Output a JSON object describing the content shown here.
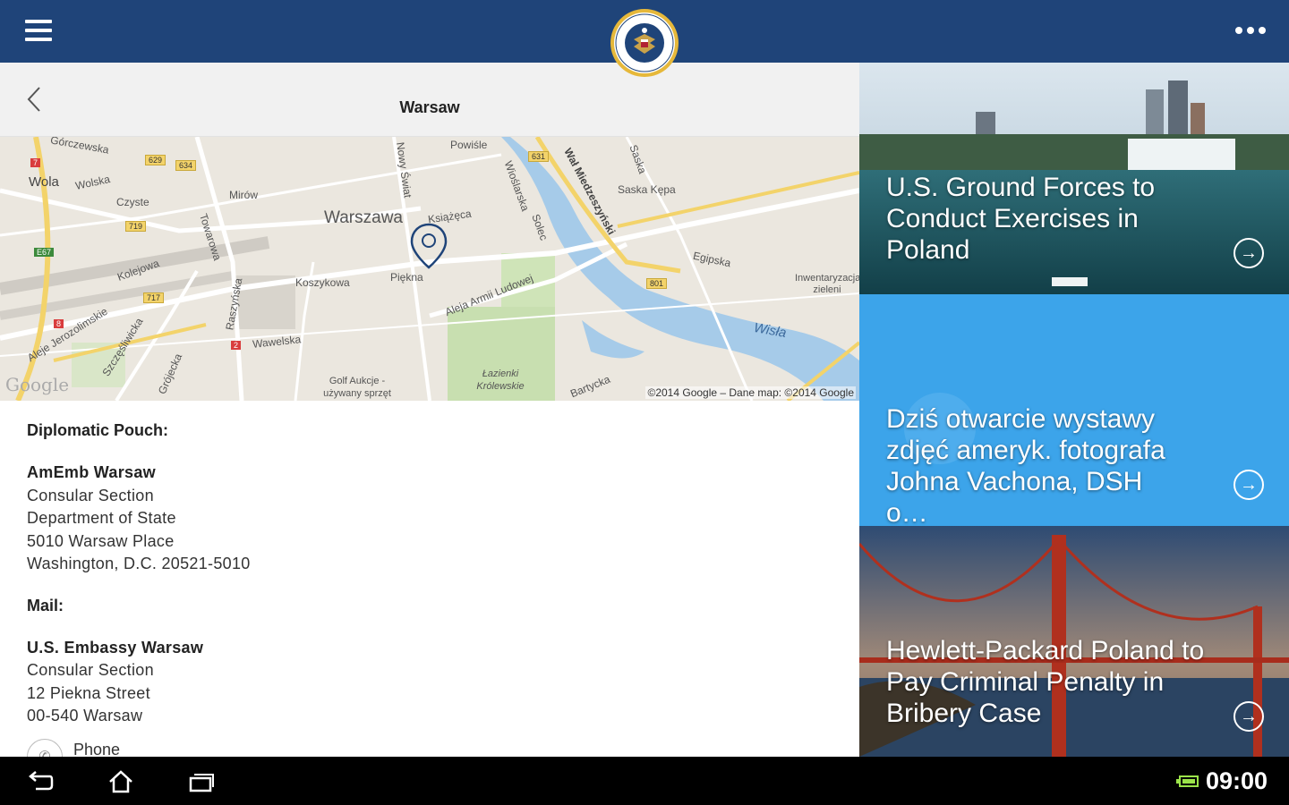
{
  "header": {
    "menu_icon": "hamburger-menu-icon",
    "logo": "us-embassy-seal",
    "more_icon": "overflow-menu-icon"
  },
  "subheader": {
    "title": "Warsaw",
    "back_icon": "chevron-left-icon"
  },
  "map": {
    "labels": {
      "gorczewska": "Górczewska",
      "wola": "Wola",
      "wolska": "Wolska",
      "czyste": "Czyste",
      "mirow": "Mirów",
      "towarowa": "Towarowa",
      "warszawa": "Warszawa",
      "ksiazeca": "Książęca",
      "nowy_swiat": "Nowy Świat",
      "powisle": "Powiśle",
      "wioslarska": "Wioślarska",
      "solec": "Solec",
      "wal_miedzeszynski": "Wał Miedzeszyński",
      "saska": "Saska",
      "saska_kepa": "Saska Kępa",
      "egipska": "Egipska",
      "inwentaryzacja": "Inwentaryzacja zieleni",
      "kolejowa": "Kolejowa",
      "koszykowa": "Koszykowa",
      "piekna": "Piękna",
      "aleja_armii": "Aleja Armii Ludowej",
      "raszynska": "Raszyńska",
      "wawelska": "Wawelska",
      "aleje_jerozolimskie": "Aleje Jerozolimskie",
      "szczesliwicka": "Szczęśliwicka",
      "grojecka": "Grójecka",
      "golf": "Golf Aukcje - używany sprzęt",
      "lazienki": "Łazienki Królewskie",
      "bartycka": "Bartycka",
      "wisla": "Wisła"
    },
    "shields": [
      "7",
      "629",
      "634",
      "719",
      "E67",
      "717",
      "8",
      "2",
      "631",
      "801"
    ],
    "copyright": "©2014 Google – Dane map: ©2014 Google",
    "google": "Google"
  },
  "details": {
    "pouch_heading": "Diplomatic Pouch:",
    "pouch_lines": [
      "AmEmb Warsaw",
      "Consular Section",
      "Department of State",
      "5010 Warsaw Place",
      "Washington, D.C. 20521-5010"
    ],
    "mail_heading": "Mail:",
    "mail_lines": [
      "U.S. Embassy Warsaw",
      "Consular Section",
      "12 Piekna Street",
      "00-540 Warsaw"
    ],
    "phone_label": "Phone"
  },
  "news": [
    {
      "title": "U.S. Ground Forces to Conduct Exercises in Poland",
      "color": "#3b6f8c"
    },
    {
      "title": "Dziś otwarcie wystawy zdjęć ameryk. fotografa Johna Vachona, DSH o…",
      "color": "#3ca4ea"
    },
    {
      "title": "Hewlett-Packard Poland to Pay Criminal Penalty in Bribery Case",
      "color": "#4a6480"
    }
  ],
  "statusbar": {
    "time": "09:00",
    "battery_icon": "battery-icon"
  },
  "navbar": {
    "back_icon": "nav-back-icon",
    "home_icon": "nav-home-icon",
    "recents_icon": "nav-recents-icon"
  }
}
